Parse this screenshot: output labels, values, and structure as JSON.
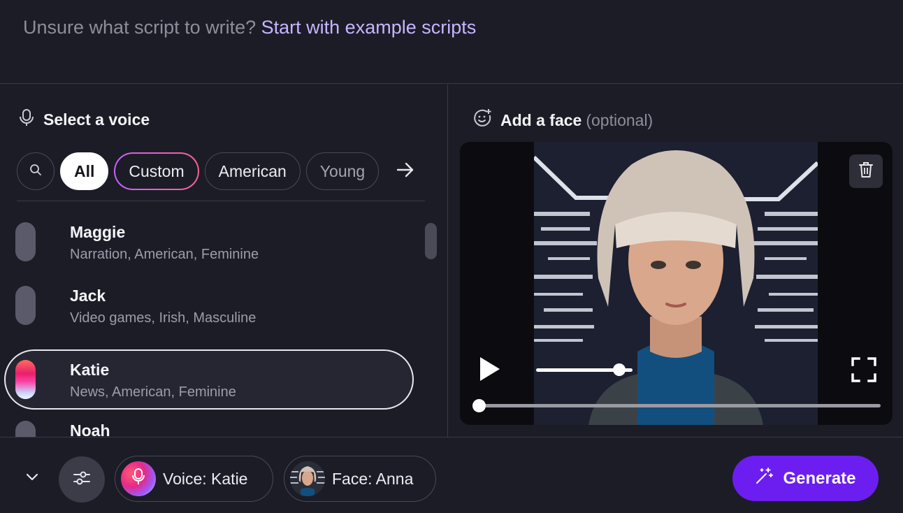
{
  "header": {
    "hint_text": "Unsure what script to write?",
    "hint_link": "Start with example scripts"
  },
  "voice_panel": {
    "title": "Select a voice",
    "title_icon": "microphone-icon",
    "filters": [
      "All",
      "Custom",
      "American",
      "Young"
    ],
    "active_filter": "All",
    "voices": [
      {
        "name": "Maggie",
        "tags": "Narration, American, Feminine"
      },
      {
        "name": "Jack",
        "tags": "Video games, Irish, Masculine"
      },
      {
        "name": "Katie",
        "tags": "News, American, Feminine"
      },
      {
        "name": "Noah",
        "tags": ""
      }
    ],
    "selected_voice": "Katie"
  },
  "face_panel": {
    "title": "Add a face",
    "title_suffix": "(optional)",
    "title_icon": "smiley-add-icon",
    "volume_level": 0.8,
    "playback_progress": 0.0
  },
  "bottom_bar": {
    "voice_label": "Voice: Katie",
    "face_label": "Face: Anna",
    "generate_label": "Generate"
  },
  "colors": {
    "background": "#1c1c27",
    "accent": "#6c1ef0",
    "link": "#c8b5ff",
    "muted_text": "#8e8e9a"
  }
}
